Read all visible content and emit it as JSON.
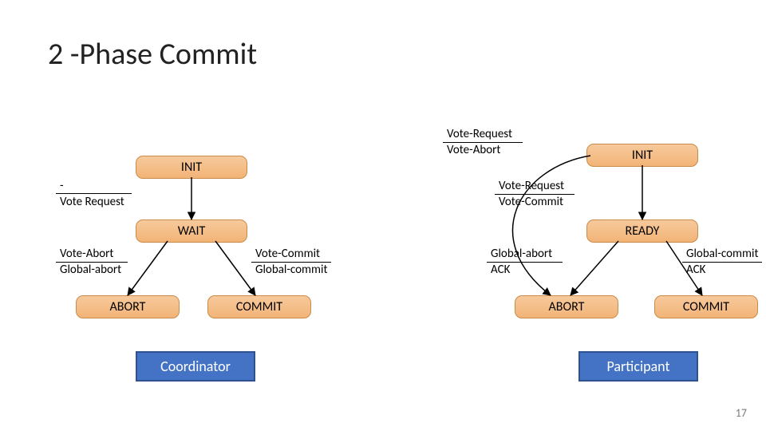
{
  "title": "2 -Phase Commit",
  "page_number": "17",
  "coordinator": {
    "role_label": "Coordinator",
    "states": {
      "init": "INIT",
      "wait": "WAIT",
      "abort": "ABORT",
      "commit": "COMMIT"
    },
    "edges": {
      "init_to_wait": {
        "event": "-",
        "action": "Vote Request"
      },
      "wait_to_abort": {
        "event": "Vote-Abort",
        "action": "Global-abort"
      },
      "wait_to_commit": {
        "event": "Vote-Commit",
        "action": "Global-commit"
      }
    }
  },
  "participant": {
    "role_label": "Participant",
    "states": {
      "init": "INIT",
      "ready": "READY",
      "abort": "ABORT",
      "commit": "COMMIT"
    },
    "edges": {
      "init_to_abort_direct": {
        "event": "Vote-Request",
        "action": "Vote-Abort"
      },
      "init_to_ready": {
        "event": "Vote-Request",
        "action": "Vote-Commit"
      },
      "ready_to_abort": {
        "event": "Global-abort",
        "action": "ACK"
      },
      "ready_to_commit": {
        "event": "Global-commit",
        "action": "ACK"
      }
    }
  }
}
